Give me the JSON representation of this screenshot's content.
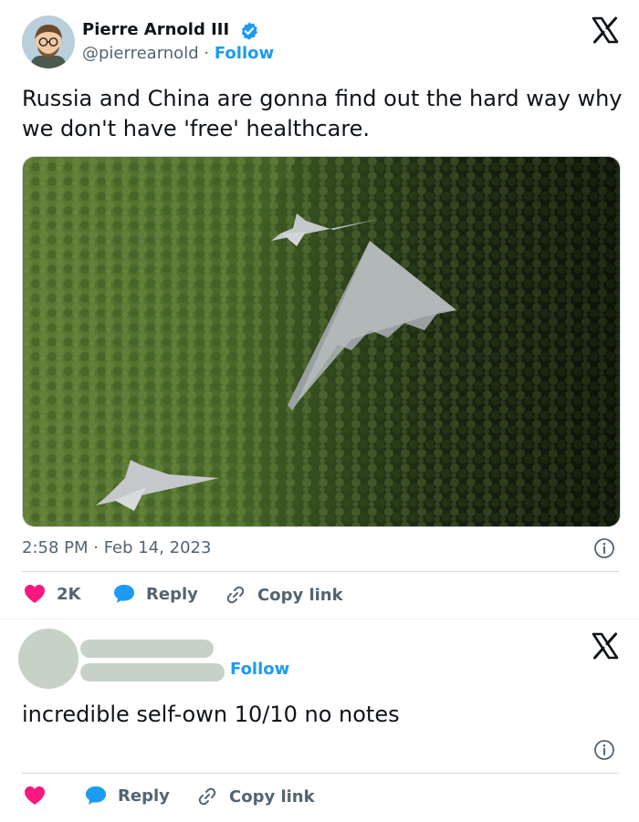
{
  "tweet": {
    "author_name": "Pierre Arnold III",
    "handle": "@pierrearnold",
    "separator": "·",
    "follow_label": "Follow",
    "text": "Russia and China are gonna find out the hard way why we don't have 'free' healthcare.",
    "timestamp": "2:58 PM · Feb 14, 2023",
    "likes": "2K",
    "reply_label": "Reply",
    "copy_link_label": "Copy link"
  },
  "reply": {
    "follow_label": "Follow",
    "text": "incredible self-own 10/10 no notes",
    "reply_label": "Reply",
    "copy_link_label": "Copy link"
  },
  "icons": {
    "verified": "verified-badge-icon",
    "x_logo": "x-logo-icon",
    "heart": "heart-icon",
    "reply": "reply-bubble-icon",
    "link": "link-icon",
    "info": "info-icon"
  },
  "colors": {
    "accent": "#1d9bf0",
    "heart": "#f91880",
    "muted": "#536471",
    "text": "#0f1419",
    "placeholder": "#c7d2c7"
  }
}
